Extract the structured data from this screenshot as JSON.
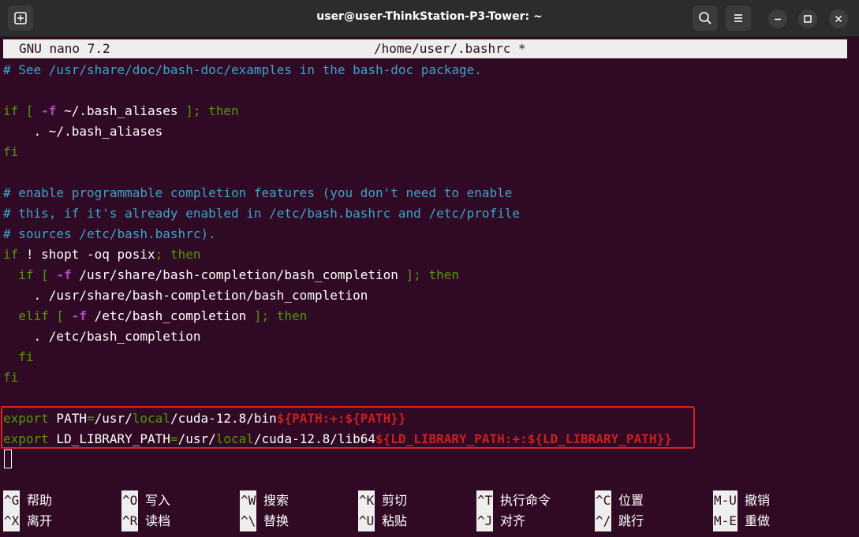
{
  "window": {
    "title": "user@user-ThinkStation-P3-Tower: ~"
  },
  "nano": {
    "version": "GNU nano 7.2",
    "file": "/home/user/.bashrc *"
  },
  "lines": {
    "l0": "# See /usr/share/doc/bash-doc/examples in the bash-doc package.",
    "l2_if": "if",
    "l2_br": " [ ",
    "l2_f": "-f",
    "l2_path": " ~/.bash_aliases ",
    "l2_end": "]; then",
    "l3": "    . ~/.bash_aliases",
    "l4": "fi",
    "l6": "# enable programmable completion features (you don't need to enable",
    "l7": "# this, if it's already enabled in /etc/bash.bashrc and /etc/profile",
    "l8": "# sources /etc/bash.bashrc).",
    "l9_if": "if",
    "l9_bang": " ! ",
    "l9_cmd": "shopt -oq posix",
    "l9_end": "; then",
    "l10_if": "  if",
    "l10_br": " [ ",
    "l10_f": "-f",
    "l10_path": " /usr/share/bash-completion/bash_completion ",
    "l10_end": "]; then",
    "l11": "    . /usr/share/bash-completion/bash_completion",
    "l12_elif": "  elif",
    "l12_br": " [ ",
    "l12_f": "-f",
    "l12_path": " /etc/bash_completion ",
    "l12_end": "]; then",
    "l13": "    . /etc/bash_completion",
    "l14": "  fi",
    "l15": "fi",
    "e1_export": "export",
    "e1_var": " PATH",
    "e1_eq": "=",
    "e1_p1": "/usr/",
    "e1_local": "local",
    "e1_p2": "/cuda-12.8/bin",
    "e1_exp": "${PATH:+:${PATH}}",
    "e2_export": "export",
    "e2_var": " LD_LIBRARY_PATH",
    "e2_eq": "=",
    "e2_p1": "/usr/",
    "e2_local": "local",
    "e2_p2": "/cuda-12.8/lib64",
    "e2_exp": "${LD_LIBRARY_PATH:+:${LD_LIBRARY_PATH}}"
  },
  "shortcuts": [
    {
      "key": "^G",
      "label": "帮助"
    },
    {
      "key": "^O",
      "label": "写入"
    },
    {
      "key": "^W",
      "label": "搜索"
    },
    {
      "key": "^K",
      "label": "剪切"
    },
    {
      "key": "^T",
      "label": "执行命令"
    },
    {
      "key": "^C",
      "label": "位置"
    },
    {
      "key": "M-U",
      "label": "撤销"
    },
    {
      "key": "^X",
      "label": "离开"
    },
    {
      "key": "^R",
      "label": "读档"
    },
    {
      "key": "^\\",
      "label": "替换"
    },
    {
      "key": "^U",
      "label": "粘贴"
    },
    {
      "key": "^J",
      "label": "对齐"
    },
    {
      "key": "^/",
      "label": "跳行"
    },
    {
      "key": "M-E",
      "label": "重做"
    }
  ]
}
